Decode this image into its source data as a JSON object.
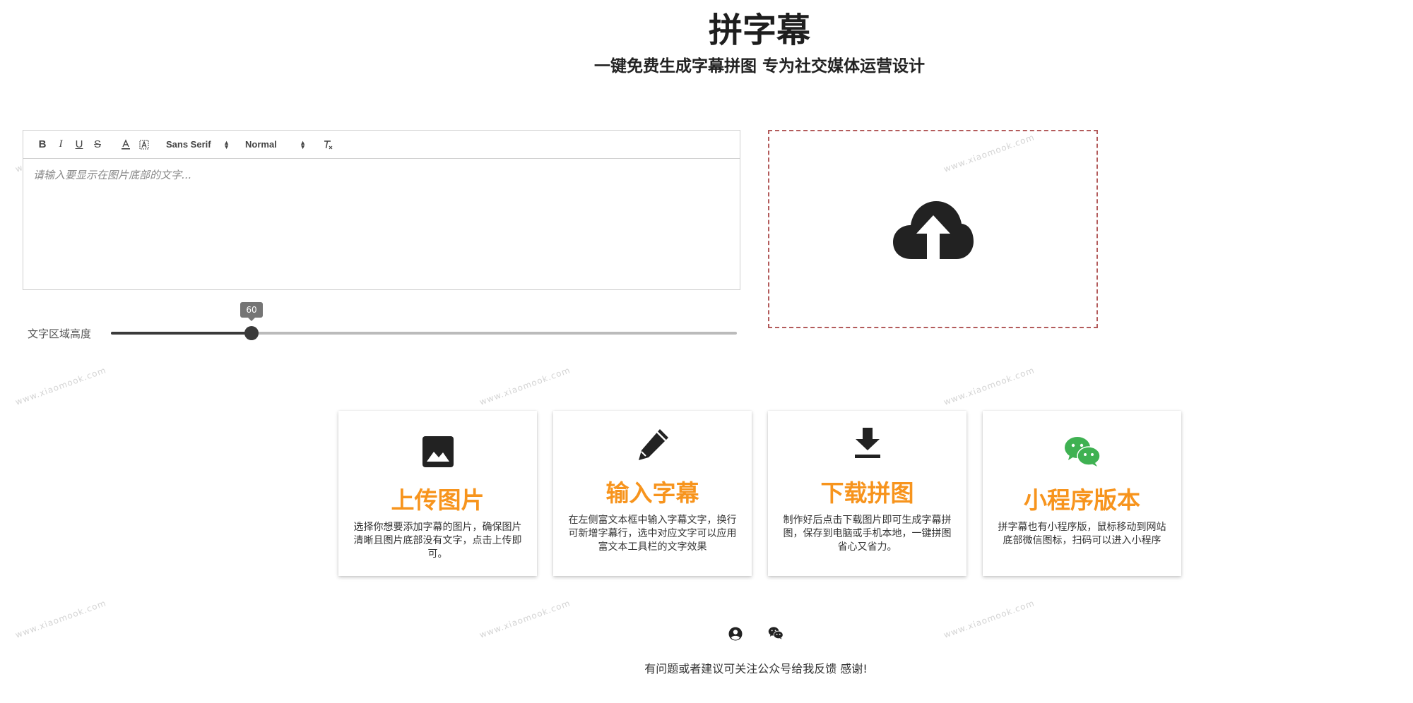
{
  "header": {
    "title": "拼字幕",
    "subtitle": "一键免费生成字幕拼图 专为社交媒体运营设计"
  },
  "watermark": "www.xiaomook.com",
  "editor": {
    "toolbar": {
      "bold": "B",
      "italic": "I",
      "underline": "U",
      "strike": "S",
      "font_family": "Sans Serif",
      "font_size": "Normal"
    },
    "placeholder": "请输入要显示在图片底部的文字..."
  },
  "slider": {
    "label": "文字区域高度",
    "value": "60",
    "fraction": 0.225
  },
  "upload": {
    "icon": "cloud-upload-icon"
  },
  "cards": [
    {
      "icon": "image-icon",
      "title": "上传图片",
      "desc": "选择你想要添加字幕的图片，确保图片清晰且图片底部没有文字，点击上传即可。"
    },
    {
      "icon": "pencil-icon",
      "title": "输入字幕",
      "desc": "在左侧富文本框中输入字幕文字，换行可新增字幕行，选中对应文字可以应用富文本工具栏的文字效果"
    },
    {
      "icon": "download-icon",
      "title": "下载拼图",
      "desc": "制作好后点击下载图片即可生成字幕拼图，保存到电脑或手机本地，一键拼图省心又省力。"
    },
    {
      "icon": "wechat-icon",
      "title": "小程序版本",
      "desc": "拼字幕也有小程序版，鼠标移动到网站底部微信图标，扫码可以进入小程序"
    }
  ],
  "colors": {
    "accent": "#f7941d",
    "wechat_green": "#3fb152",
    "dashed_border": "#b35b5b"
  },
  "footer": {
    "icons": [
      "account-circle-icon",
      "wechat-icon"
    ],
    "text": "有问题或者建议可关注公众号给我反馈 感谢!"
  }
}
